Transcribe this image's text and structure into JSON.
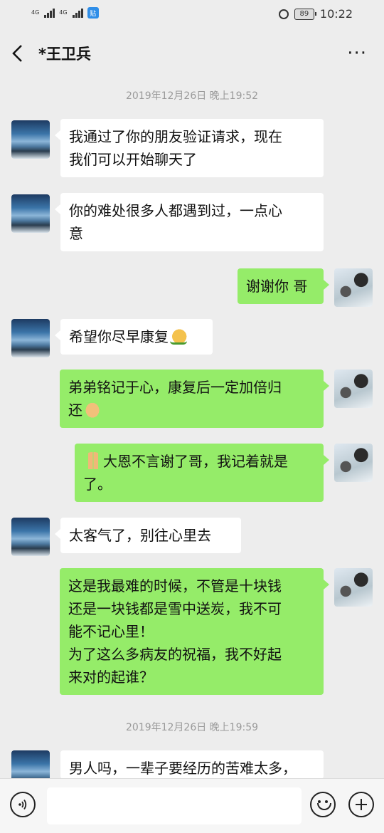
{
  "status_bar": {
    "network_1": "4G",
    "network_2": "4G",
    "app_badge": "贴",
    "battery": "89",
    "time": "10:22"
  },
  "header": {
    "title": "*王卫兵",
    "more": "···"
  },
  "timestamps": [
    "2019年12月26日 晚上19:52",
    "2019年12月26日 晚上19:59"
  ],
  "messages": [
    {
      "side": "left",
      "lines": [
        "我通过了你的朋友验证请求，现在",
        "我们可以开始聊天了"
      ]
    },
    {
      "side": "left",
      "lines": [
        "你的难处很多人都遇到过，一点心",
        "意"
      ]
    },
    {
      "side": "right",
      "lines": [
        "谢谢你 哥"
      ]
    },
    {
      "side": "left",
      "lines": [
        "希望你尽早康复"
      ],
      "emoji": "thumbs-up-emoji"
    },
    {
      "side": "right",
      "lines": [
        "弟弟铭记于心，康复后一定加倍归",
        "还"
      ],
      "emoji": "handshake-emoji"
    },
    {
      "side": "right",
      "lines": [
        "大恩不言谢了哥，我记着就是",
        "了。"
      ],
      "emoji": "pray-emoji"
    },
    {
      "side": "left",
      "lines": [
        "太客气了，别往心里去"
      ]
    },
    {
      "side": "right",
      "lines": [
        "这是我最难的时候，不管是十块钱",
        "还是一块钱都是雪中送炭，我不可",
        "能不记心里！",
        "为了这么多病友的祝福，我不好起",
        "来对的起谁？"
      ]
    },
    {
      "side": "left",
      "lines": [
        "男人吗，一辈子要经历的苦难太多，"
      ]
    }
  ],
  "colors": {
    "background": "#ededed",
    "bubble_self": "#95ec69",
    "bubble_other": "#ffffff"
  },
  "input_bar": {
    "voice_icon": "voice-icon",
    "emoji_icon": "emoji-icon",
    "plus_icon": "plus-icon"
  }
}
